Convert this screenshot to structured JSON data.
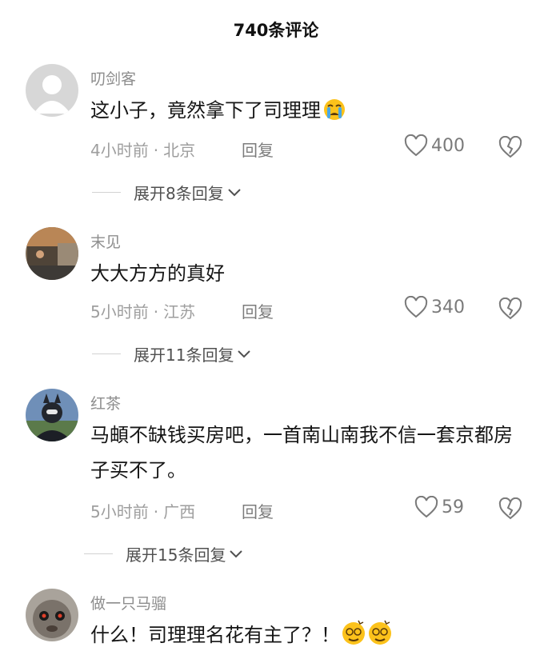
{
  "header": {
    "title": "740条评论"
  },
  "comments": [
    {
      "username": "叨剑客",
      "text": "这小子，竟然拿下了司理理",
      "emoji": "crying-face-icon",
      "time": "4小时前",
      "location": "北京",
      "reply_label": "回复",
      "likes": "400",
      "expand_label": "展开8条回复"
    },
    {
      "username": "末见",
      "text": "大大方方的真好",
      "time": "5小时前",
      "location": "江苏",
      "reply_label": "回复",
      "likes": "340",
      "expand_label": "展开11条回复"
    },
    {
      "username": "红茶",
      "text": "马頔不缺钱买房吧，一首南山南我不信一套京都房子买不了。",
      "time": "5小时前",
      "location": "广西",
      "reply_label": "回复",
      "likes": "59",
      "expand_label": "展开15条回复"
    },
    {
      "username": "做一只马骝",
      "text": "什么！司理理名花有主了？！",
      "emoji": "dizzy-face-icon"
    }
  ],
  "colors": {
    "username": "#8d8d8d",
    "meta": "#9e9e9e",
    "icon": "#7a7a7a"
  }
}
